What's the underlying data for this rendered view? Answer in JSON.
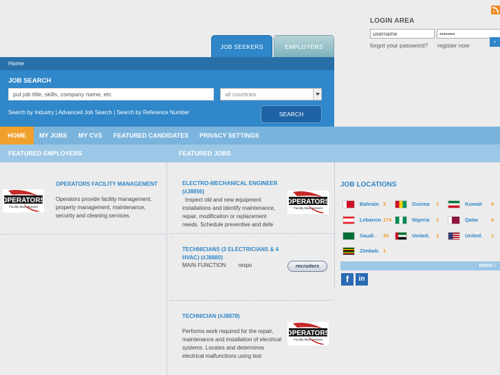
{
  "login": {
    "title": "LOGIN AREA",
    "username_value": "username",
    "password_value": "********",
    "forgot": "forgot your password?",
    "register": "register now",
    "go": "›"
  },
  "tabs": {
    "seekers": "JOB SEEKERS",
    "employers": "EMPLOYERS"
  },
  "breadcrumb": "Home",
  "search": {
    "title": "JOB SEARCH",
    "placeholder": "put job title, skills, company name, etc",
    "country": "all countries",
    "links": "Search by Industry |  Advanced Job Search |  Search by Reference Number",
    "button": "SEARCH"
  },
  "menu": [
    "HOME",
    "MY JOBS",
    "MY CVS",
    "FEATURED CANDIDATES",
    "PRIVACY SETTINGS"
  ],
  "sections": {
    "employers": "FEATURED EMPLOYERS",
    "jobs": "FEATURED JOBS"
  },
  "employer": {
    "name": "OPERATORS FACILITY MANAGEMENT",
    "description": "Operators provide facility management, property management, maintenance, security and cleaning services.",
    "logo_text": "OPERATORS",
    "logo_sub": "Facility Management"
  },
  "jobs": [
    {
      "title": "ELECTRO-MECHANICAL ENGINEER (#J8856)",
      "description": "Inspect old and new equipment installations and identify maintenance, repair, modification or replacement needs. Schedule preventive and defe"
    },
    {
      "title": "TECHNICIANS (3 ELECTRICIANS & 4 HVAC) (#J8880)",
      "description": "MAIN FUNCTION        respo"
    },
    {
      "title": "TECHNICIAN (#J8878)",
      "description": "Performs work required for the repair, maintenance and installation of electrical systems. Locates and determines electrical malfunctions using test"
    }
  ],
  "recruiters_logo": "recruiters",
  "locations": {
    "title": "JOB LOCATIONS",
    "items": [
      {
        "name": "Bahrain",
        "count": "3",
        "flag": "bahrain-flag-icon"
      },
      {
        "name": "Guinea",
        "count": "1",
        "flag": "guinea-flag-icon"
      },
      {
        "name": "Kuwait",
        "count": "9",
        "flag": "kuwait-flag-icon"
      },
      {
        "name": "Lebanon",
        "count": "174",
        "flag": "lebanon-flag-icon"
      },
      {
        "name": "Nigeria",
        "count": "1",
        "flag": "nigeria-flag-icon"
      },
      {
        "name": "Qatar",
        "count": "6",
        "flag": "qatar-flag-icon"
      },
      {
        "name": "Saudi .",
        "count": "30",
        "flag": "saudi-flag-icon"
      },
      {
        "name": "United.",
        "count": "3",
        "flag": "uae-flag-icon"
      },
      {
        "name": "United.",
        "count": "1",
        "flag": "usa-flag-icon"
      },
      {
        "name": "Zimbab.",
        "count": "1",
        "flag": "zimbabwe-flag-icon"
      }
    ],
    "more": "more ›"
  },
  "social": {
    "facebook": "f",
    "linkedin": "in"
  }
}
